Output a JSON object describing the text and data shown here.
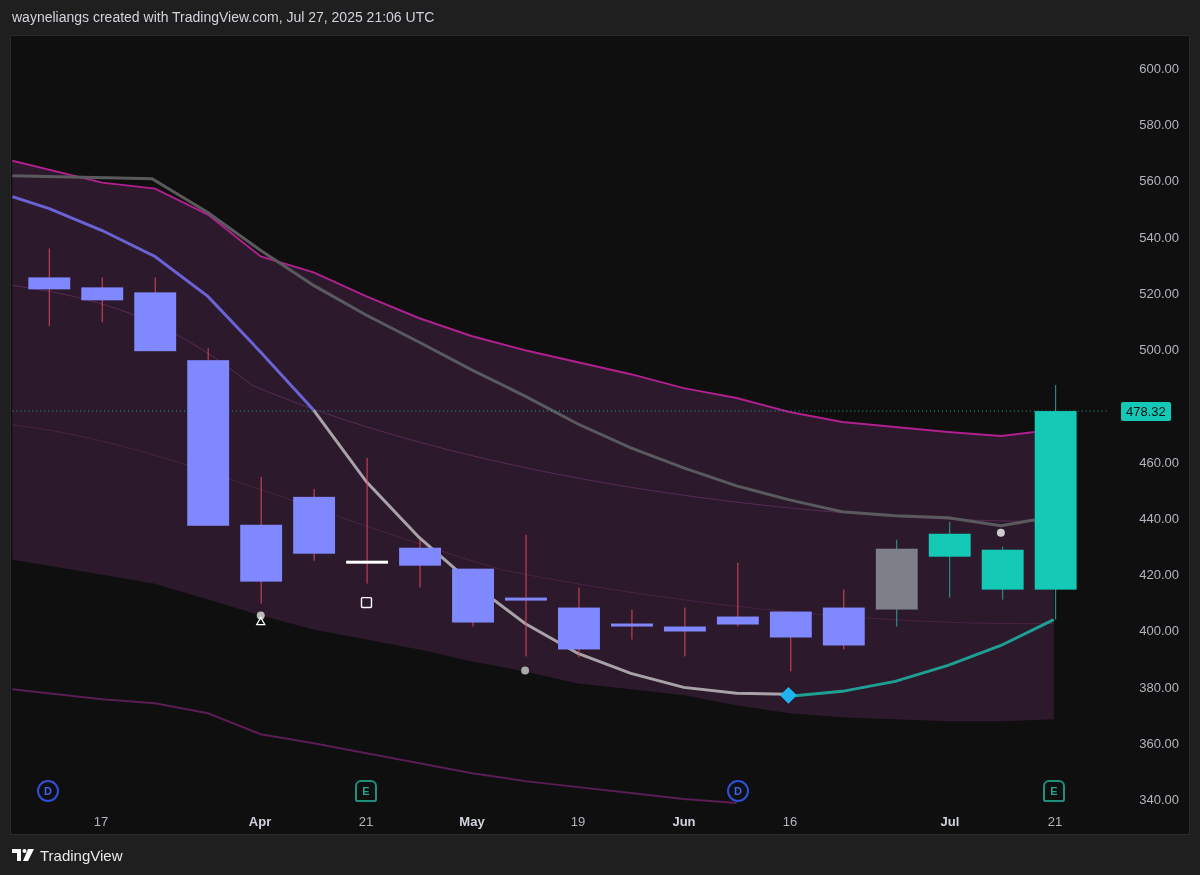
{
  "header": {
    "text": "wayneliangs created with TradingView.com, Jul 27, 2025 21:06 UTC"
  },
  "price_axis": {
    "labels": [
      "600.00",
      "580.00",
      "560.00",
      "540.00",
      "520.00",
      "500.00",
      "460.00",
      "440.00",
      "420.00",
      "400.00",
      "380.00",
      "360.00",
      "340.00"
    ],
    "last_price": "478.32"
  },
  "time_axis": {
    "labels": [
      {
        "text": "17",
        "kind": "day"
      },
      {
        "text": "Apr",
        "kind": "month"
      },
      {
        "text": "21",
        "kind": "day"
      },
      {
        "text": "May",
        "kind": "month"
      },
      {
        "text": "19",
        "kind": "day"
      },
      {
        "text": "Jun",
        "kind": "month"
      },
      {
        "text": "16",
        "kind": "day"
      },
      {
        "text": "Jul",
        "kind": "month"
      },
      {
        "text": "21",
        "kind": "day"
      }
    ]
  },
  "events": [
    {
      "kind": "dividend",
      "letter": "D"
    },
    {
      "kind": "earnings",
      "letter": "E"
    },
    {
      "kind": "dividend",
      "letter": "D"
    },
    {
      "kind": "earnings",
      "letter": "E"
    }
  ],
  "footer": {
    "brand": "TradingView"
  }
}
